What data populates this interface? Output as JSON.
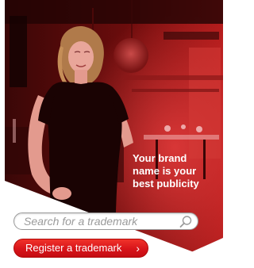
{
  "banner": {
    "tagline_line1": "Your brand",
    "tagline_line2": "name is your",
    "tagline_line3": "best publicity",
    "photo_icon": "woman-in-restaurant-photo"
  },
  "search": {
    "placeholder": "Search for a trademark",
    "value": "",
    "icon": "search-icon"
  },
  "register": {
    "label": "Register a trademark",
    "chevron": "›",
    "icon": "chevron-right-icon"
  },
  "colors": {
    "accent_red": "#d8141a",
    "photo_tint": "#5a0a0a"
  }
}
